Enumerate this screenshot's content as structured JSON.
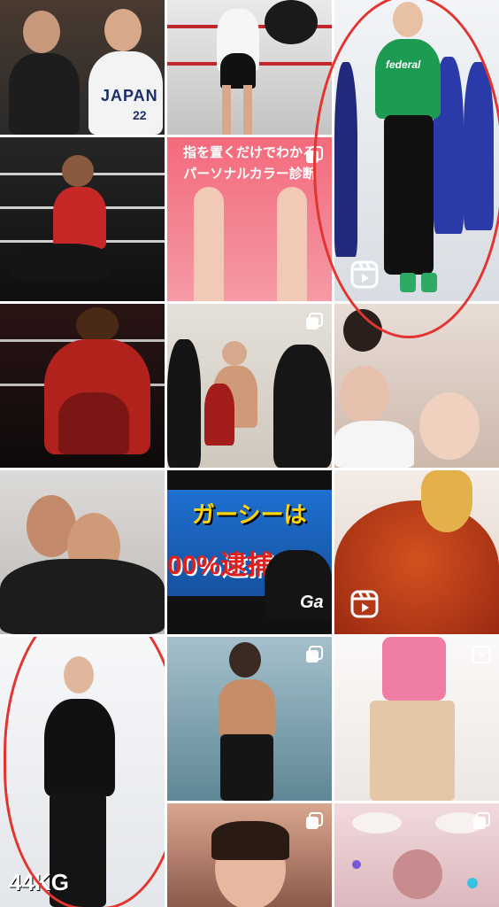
{
  "grid": {
    "tiles": [
      {
        "row": 0,
        "col": 0,
        "type": "photo",
        "caption": "",
        "accent": "#2a2a2a"
      },
      {
        "row": 0,
        "col": 1,
        "type": "photo",
        "caption": "",
        "accent": "#d9d9d9"
      },
      {
        "row": 0,
        "col": 2,
        "type": "reel",
        "caption": "",
        "accent": "#e9eef3"
      },
      {
        "row": 1,
        "col": 0,
        "type": "photo",
        "caption": "",
        "accent": "#1a1a1a"
      },
      {
        "row": 1,
        "col": 1,
        "type": "carousel",
        "caption": "指を置くだけでわかる\nパーソナルカラー診断",
        "accent": "#f07a88"
      },
      {
        "row": 1,
        "col": 2,
        "type": "reel",
        "caption": "",
        "accent": "#e9eef3"
      },
      {
        "row": 2,
        "col": 0,
        "type": "photo",
        "caption": "",
        "accent": "#1e1212"
      },
      {
        "row": 2,
        "col": 1,
        "type": "carousel",
        "caption": "",
        "accent": "#d7d2c8"
      },
      {
        "row": 2,
        "col": 2,
        "type": "photo",
        "caption": "",
        "accent": "#d4c1b8"
      },
      {
        "row": 3,
        "col": 0,
        "type": "photo",
        "caption": "",
        "accent": "#c9c6c4"
      },
      {
        "row": 3,
        "col": 1,
        "type": "photo",
        "caption": "ガーシーは\n00%逮捕",
        "accent": "#1b64b8"
      },
      {
        "row": 3,
        "col": 2,
        "type": "reel",
        "caption": "",
        "accent": "#b33a1e"
      },
      {
        "row": 4,
        "col": 0,
        "type": "reel",
        "caption": "44KG",
        "accent": "#eef0f2"
      },
      {
        "row": 4,
        "col": 1,
        "type": "carousel",
        "caption": "",
        "accent": "#7fa9b9"
      },
      {
        "row": 4,
        "col": 2,
        "type": "reel",
        "caption": "",
        "accent": "#f5f3f1"
      },
      {
        "row": 5,
        "col": 0,
        "type": "photo",
        "caption": "",
        "accent": "#efefef"
      },
      {
        "row": 5,
        "col": 1,
        "type": "carousel",
        "caption": "",
        "accent": "#b07a6b"
      },
      {
        "row": 5,
        "col": 2,
        "type": "carousel",
        "caption": "",
        "accent": "#e7d0d3"
      }
    ]
  },
  "texts": {
    "personal_color_line1": "指を置くだけでわかる",
    "personal_color_line2": "パーソナルカラー診断",
    "gaasy_line1": "ガーシーは",
    "gaasy_line2": "00%逮捕",
    "gaasy_tag": "Ga",
    "weight_label": "44KG",
    "federal": "federal",
    "japan_jersey": "JAPAN",
    "jersey_number": "22"
  }
}
